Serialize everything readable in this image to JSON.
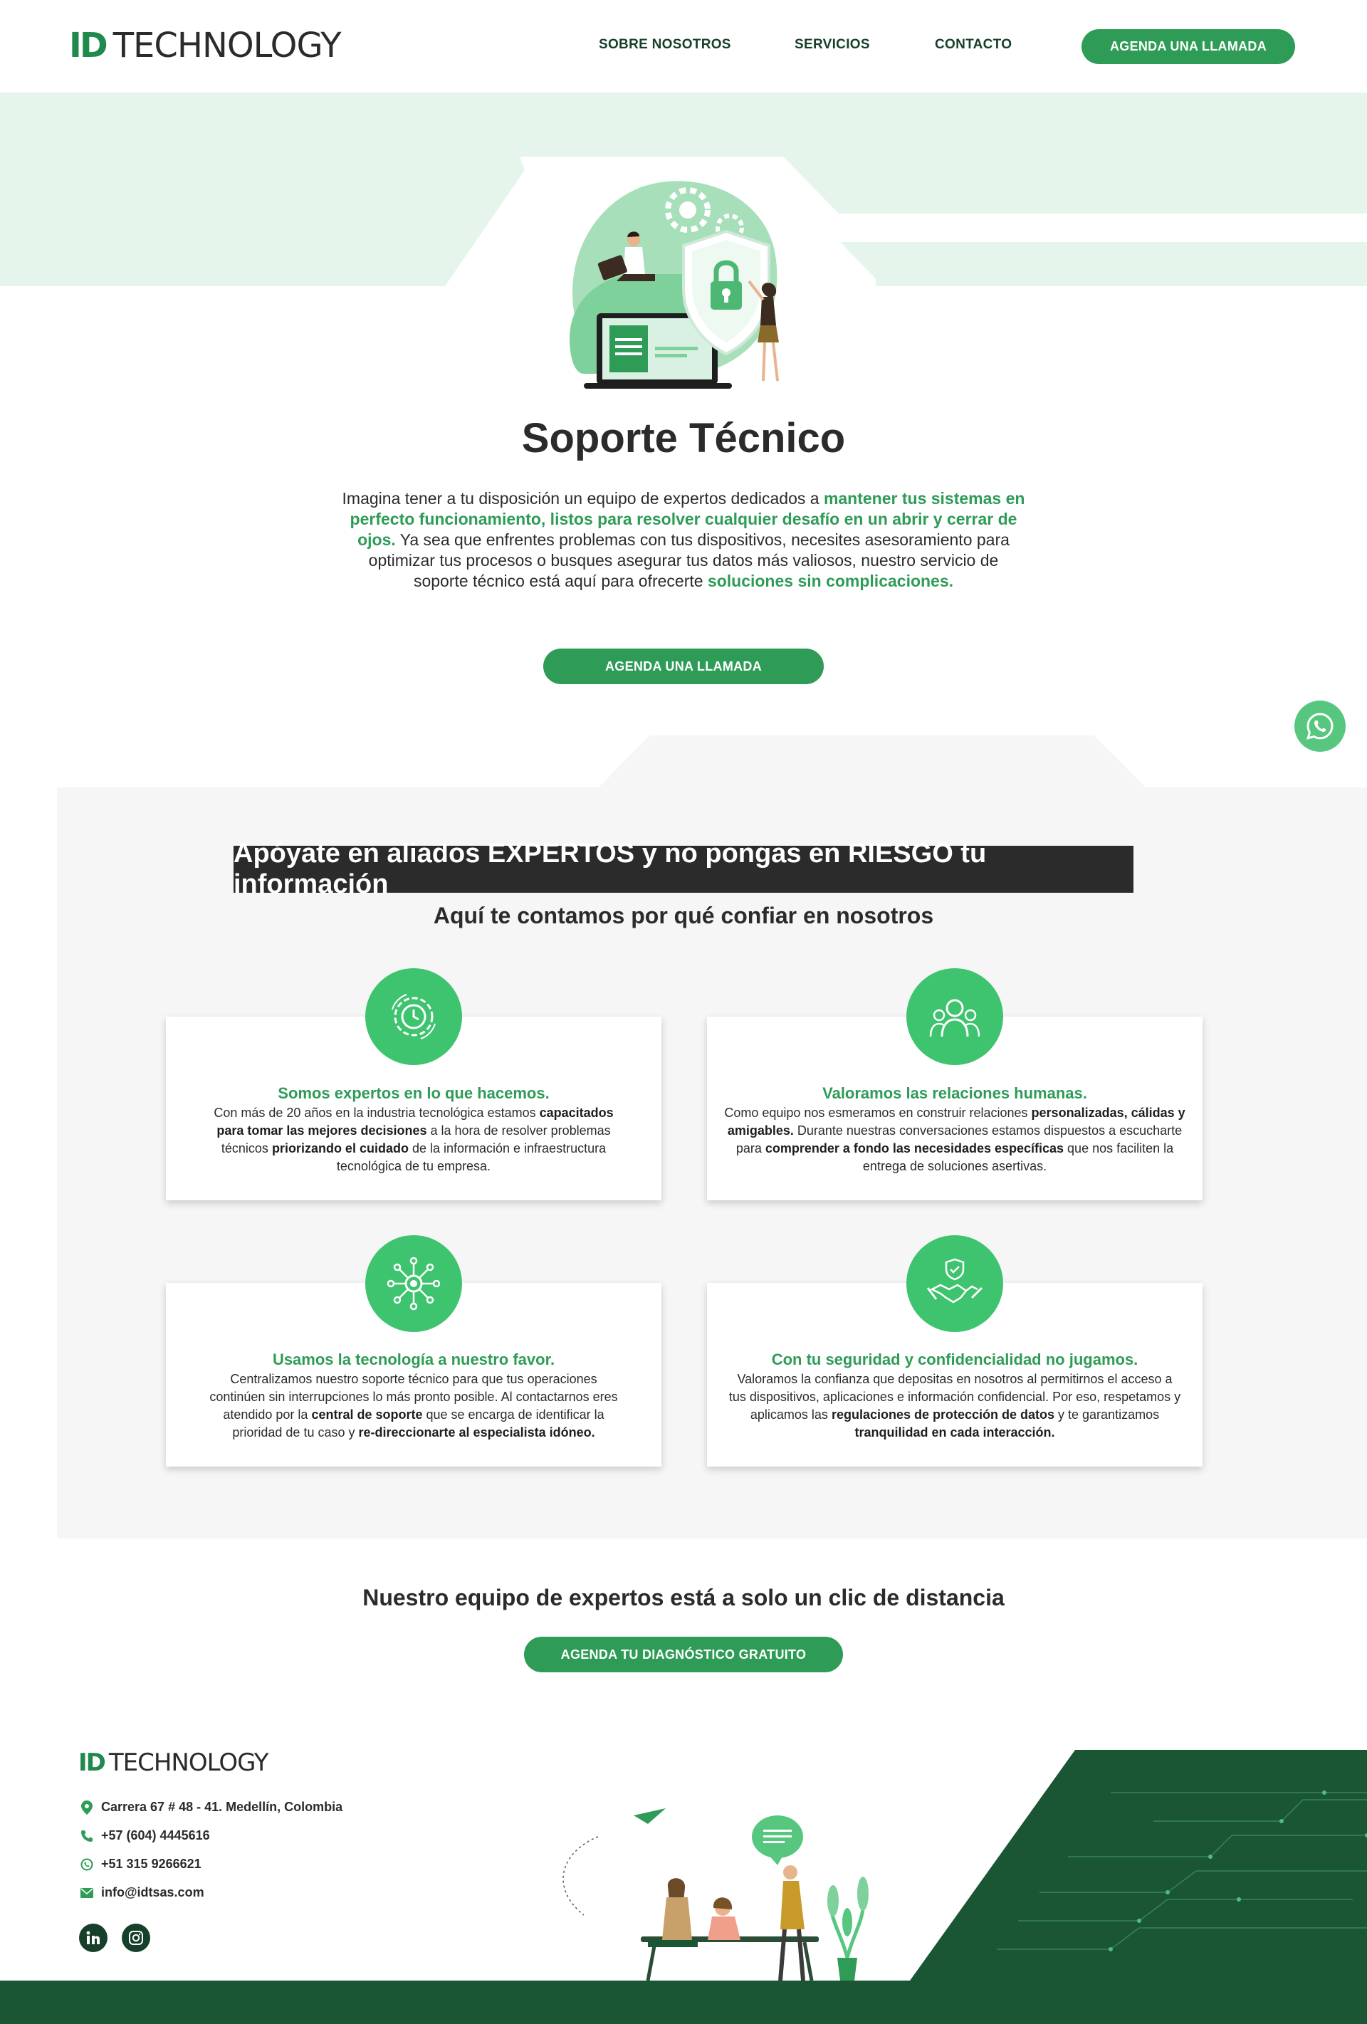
{
  "brand": {
    "mark": "ID",
    "name": "TECHNOLOGY",
    "color": "#1f8a4c"
  },
  "nav": {
    "items": [
      {
        "label": "SOBRE NOSOTROS"
      },
      {
        "label": "SERVICIOS"
      },
      {
        "label": "CONTACTO"
      }
    ],
    "cta": "AGENDA UNA LLAMADA"
  },
  "hero": {
    "title": "Soporte Técnico",
    "text_parts": [
      "Imagina tener a tu disposición un equipo de expertos dedicados a ",
      "mantener tus sistemas en perfecto funcionamiento, listos para resolver cualquier desafío en un abrir y cerrar de ojos.",
      " Ya sea que enfrentes problemas con tus dispositivos, necesites asesoramiento para optimizar tus procesos o busques asegurar tus datos más valiosos, nuestro servicio de soporte técnico está aquí para ofrecerte ",
      "soluciones sin complicaciones."
    ],
    "cta": "AGENDA UNA LLAMADA"
  },
  "why": {
    "banner": "Apóyate en aliados EXPERTOS y no pongas en RIESGO tu información",
    "subtitle": "Aquí te contamos por qué confiar en nosotros",
    "cards": [
      {
        "icon": "gear-clock-icon",
        "title": "Somos expertos en lo que hacemos.",
        "parts": [
          [
            "Con más de 20 años en la industria tecnológica estamos ",
            false
          ],
          [
            "capacitados para tomar las mejores decisiones",
            true
          ],
          [
            " a la hora de resolver problemas técnicos ",
            false
          ],
          [
            "priorizando el cuidado",
            true
          ],
          [
            " de la información e infraestructura tecnológica de tu empresa.",
            false
          ]
        ]
      },
      {
        "icon": "people-group-icon",
        "title": "Valoramos las relaciones humanas.",
        "parts": [
          [
            "Como equipo nos esmeramos en construir relaciones ",
            false
          ],
          [
            "personalizadas, cálidas y amigables.",
            true
          ],
          [
            " Durante nuestras conversaciones estamos dispuestos a escucharte para ",
            false
          ],
          [
            "comprender a fondo las necesidades específicas",
            true
          ],
          [
            " que nos faciliten la entrega de soluciones asertivas.",
            false
          ]
        ]
      },
      {
        "icon": "network-hub-icon",
        "title": "Usamos la tecnología a nuestro favor.",
        "parts": [
          [
            "Centralizamos nuestro soporte técnico para que tus operaciones continúen sin interrupciones lo más pronto posible. Al contactarnos eres atendido por la ",
            false
          ],
          [
            "central de soporte",
            true
          ],
          [
            " que se encarga de identificar la prioridad de tu caso y ",
            false
          ],
          [
            "re-direccionarte al especialista idóneo.",
            true
          ]
        ]
      },
      {
        "icon": "handshake-shield-icon",
        "title": "Con tu seguridad y confidencialidad no jugamos.",
        "parts": [
          [
            "Valoramos la confianza que depositas en nosotros al permitirnos el acceso a tus dispositivos, aplicaciones e información confidencial. Por eso, respetamos y aplicamos las ",
            false
          ],
          [
            "regulaciones de protección de datos",
            true
          ],
          [
            " y te garantizamos ",
            false
          ],
          [
            "tranquilidad en cada interacción.",
            true
          ]
        ]
      }
    ]
  },
  "cta_section": {
    "title": "Nuestro equipo de expertos está a solo un clic de distancia",
    "button": "AGENDA TU DIAGNÓSTICO GRATUITO"
  },
  "footer": {
    "address": "Carrera 67 # 48 - 41. Medellín, Colombia",
    "phone": "+57 (604) 4445616",
    "whatsapp": "+51 315 9266621",
    "email": "info@idtsas.com",
    "social": [
      "linkedin-icon",
      "instagram-icon"
    ]
  },
  "colors": {
    "accent": "#2e9b57",
    "accent_light": "#3ec36e",
    "hero_bg": "#e6f5ec",
    "dark": "#2b2b2b",
    "footer_green": "#1a5633"
  }
}
